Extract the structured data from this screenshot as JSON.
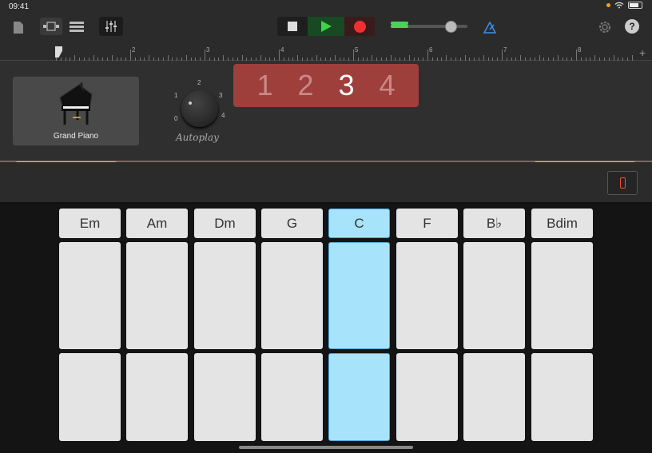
{
  "status": {
    "time": "09:41"
  },
  "toolbar": {
    "icons": [
      "file-icon",
      "tracks-view-icon",
      "list-view-icon",
      "mixer-icon",
      "stop-icon",
      "play-icon",
      "record-icon",
      "metronome-icon",
      "settings-icon",
      "help-icon"
    ],
    "help_label": "?"
  },
  "ruler": {
    "marks": [
      "2",
      "3",
      "4",
      "5",
      "6",
      "7",
      "8"
    ],
    "add_label": "+"
  },
  "instrument": {
    "name": "Grand Piano"
  },
  "autoplay": {
    "label": "Autoplay",
    "positions": [
      "0",
      "1",
      "2",
      "3",
      "4"
    ]
  },
  "sections": {
    "items": [
      "1",
      "2",
      "3",
      "4"
    ],
    "selected": "3"
  },
  "chords": {
    "items": [
      "Em",
      "Am",
      "Dm",
      "G",
      "C",
      "F",
      "B♭",
      "Bdim"
    ],
    "selected": "C"
  },
  "colors": {
    "accent_selected": "#a7e3fa",
    "record": "#f03030",
    "play": "#3fd24a",
    "section_bg": "#9e3f3c"
  }
}
